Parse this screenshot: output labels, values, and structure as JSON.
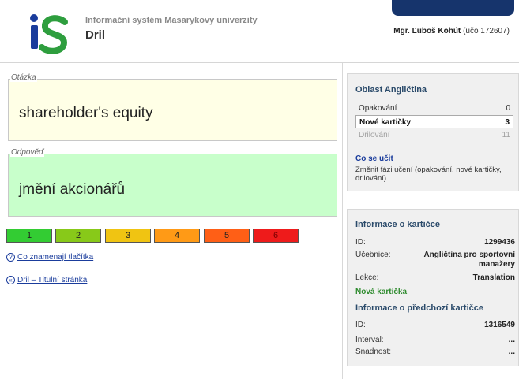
{
  "header": {
    "system_name": "Informační systém Masarykovy univerzity",
    "app_name": "Dril",
    "user_name": "Mgr. Ľuboš Kohút",
    "user_uco": "(učo 172607)",
    "logo_colors": {
      "i": "#1a3c9c",
      "s": "#2e9e3e"
    }
  },
  "question": {
    "legend": "Otázka",
    "text": "shareholder's equity"
  },
  "answer": {
    "legend": "Odpověď",
    "text": "jmění akcionářů"
  },
  "rating_buttons": [
    "1",
    "2",
    "3",
    "4",
    "5",
    "6"
  ],
  "links": {
    "help": "Co znamenají tlačítka",
    "home": "Dril – Titulní stránka"
  },
  "area_panel": {
    "title": "Oblast Angličtina",
    "rows": [
      {
        "label": "Opakování",
        "value": "0"
      },
      {
        "label": "Nové kartičky",
        "value": "3"
      },
      {
        "label": "Drilování",
        "value": "11"
      }
    ],
    "learn_link": "Co se učit",
    "learn_desc": "Změnit fázi učení (opakování, nové kartičky, drilování)."
  },
  "info_panel": {
    "title": "Informace o kartičce",
    "id_label": "ID:",
    "id_value": "1299436",
    "book_label": "Učebnice:",
    "book_value": "Angličtina pro sportovní manažery",
    "lesson_label": "Lekce:",
    "lesson_value": "Translation",
    "new_card": "Nová kartička",
    "prev_title": "Informace o předchozí kartičce",
    "prev_id_label": "ID:",
    "prev_id_value": "1316549",
    "interval_label": "Interval:",
    "interval_value": "...",
    "ease_label": "Snadnost:",
    "ease_value": "..."
  }
}
